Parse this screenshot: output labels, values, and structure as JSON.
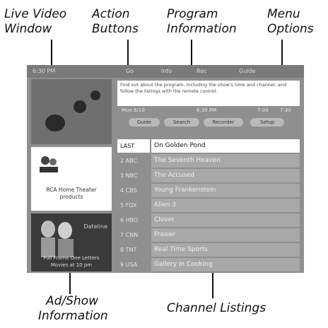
{
  "callouts": {
    "live_video": [
      "Live Video",
      "Window"
    ],
    "action_buttons": [
      "Action",
      "Buttons"
    ],
    "program_information": [
      "Program",
      "Information"
    ],
    "menu_options": [
      "Menu",
      "Options"
    ],
    "ad_show": [
      "Ad/Show",
      "Information"
    ],
    "channel_listings": [
      "Channel Listings"
    ]
  },
  "screen": {
    "top_bar": [
      "6:30 PM",
      "Go",
      "Info",
      "Rec",
      "Guide"
    ],
    "program_info_text": "Find out about the program, including the show's time and channel, and follow the listings with the remote control.",
    "row": [
      "Mon 6/10",
      "6:30 PM",
      "7:00",
      "7:30"
    ],
    "menu_tabs": [
      "Guide",
      "Search",
      "Recorder",
      "Setup"
    ],
    "ad_caption": [
      "RCA Home Theater",
      "products"
    ],
    "show_title": "Dateline",
    "show_caption": [
      "Full Frame One Letters",
      "Movies at 10 pm"
    ],
    "listings": [
      {
        "ch": "LAST",
        "prog": "On Golden Pond"
      },
      {
        "ch": "2 ABC",
        "prog": "The Seventh Heaven"
      },
      {
        "ch": "3 NBC",
        "prog": "The Accused"
      },
      {
        "ch": "4 CBS",
        "prog": "Young Frankenstein"
      },
      {
        "ch": "5 FOX",
        "prog": "Alien 3"
      },
      {
        "ch": "6 HBO",
        "prog": "Clover"
      },
      {
        "ch": "7 CNN",
        "prog": "Frasier"
      },
      {
        "ch": "8 TNT",
        "prog": "Real Time Sports"
      },
      {
        "ch": "9 USA",
        "prog": "Gallery in Cooking"
      }
    ]
  }
}
